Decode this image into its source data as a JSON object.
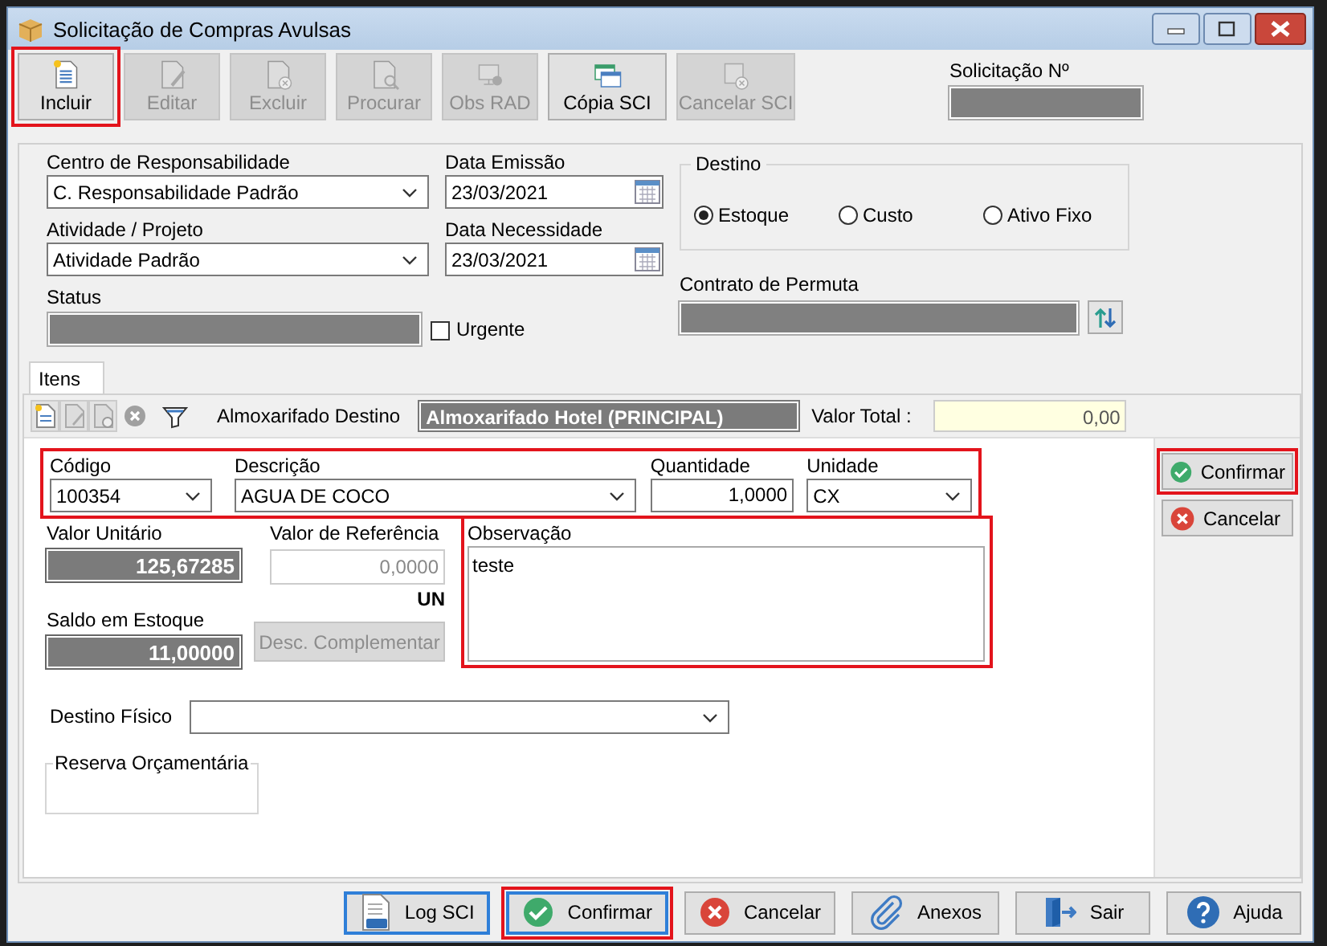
{
  "window": {
    "title": "Solicitação de Compras Avulsas"
  },
  "toolbar": [
    {
      "kind": "new",
      "label": "Incluir",
      "disabled": false,
      "highlighted": true
    },
    {
      "kind": "edit",
      "label": "Editar",
      "disabled": true,
      "highlighted": false
    },
    {
      "kind": "delete",
      "label": "Excluir",
      "disabled": true,
      "highlighted": false
    },
    {
      "kind": "search",
      "label": "Procurar",
      "disabled": true,
      "highlighted": false
    },
    {
      "kind": "note",
      "label": "Obs RAD",
      "disabled": true,
      "highlighted": false
    },
    {
      "kind": "copy",
      "label": "Cópia SCI",
      "disabled": false,
      "highlighted": false
    },
    {
      "kind": "cancel",
      "label": "Cancelar SCI",
      "disabled": true,
      "highlighted": false
    }
  ],
  "request_number": {
    "label": "Solicitação Nº"
  },
  "header": {
    "responsibility_center": {
      "label": "Centro de Responsabilidade",
      "value": "C. Responsabilidade Padrão"
    },
    "activity": {
      "label": "Atividade / Projeto",
      "value": "Atividade Padrão"
    },
    "status": {
      "label": "Status"
    },
    "urgent": {
      "label": "Urgente",
      "checked": false
    },
    "issue_date": {
      "label": "Data Emissão",
      "value": "23/03/2021"
    },
    "need_date": {
      "label": "Data Necessidade",
      "value": "23/03/2021"
    },
    "destination": {
      "title": "Destino",
      "options": [
        {
          "label": "Estoque",
          "selected": true
        },
        {
          "label": "Custo",
          "selected": false
        },
        {
          "label": "Ativo Fixo",
          "selected": false
        }
      ]
    },
    "exchange_contract": {
      "label": "Contrato de Permuta"
    }
  },
  "tabs": [
    {
      "label": "Itens",
      "selected": true
    }
  ],
  "items_bar": {
    "warehouse_label": "Almoxarifado Destino",
    "warehouse_value": "Almoxarifado Hotel (PRINCIPAL)",
    "total_label": "Valor Total :",
    "total_value": "0,00"
  },
  "item": {
    "code": {
      "label": "Código",
      "value": "100354"
    },
    "description": {
      "label": "Descrição",
      "value": "AGUA DE COCO"
    },
    "quantity": {
      "label": "Quantidade",
      "value": "1,0000"
    },
    "unit": {
      "label": "Unidade",
      "value": "CX"
    },
    "unit_value": {
      "label": "Valor Unitário",
      "value": "125,67285"
    },
    "reference_value": {
      "label": "Valor de Referência",
      "value": "0,0000"
    },
    "unit_hint": "UN",
    "stock_balance": {
      "label": "Saldo em Estoque",
      "value": "11,00000"
    },
    "complement_button": {
      "label": "Desc. Complementar",
      "disabled": true
    },
    "notes": {
      "label": "Observação",
      "value": "teste"
    },
    "physical_destination": {
      "label": "Destino Físico"
    },
    "budget_reserve": {
      "title": "Reserva Orçamentária"
    }
  },
  "side_buttons": [
    {
      "kind": "confirm",
      "label": "Confirmar",
      "highlighted": true
    },
    {
      "kind": "cancel",
      "label": "Cancelar",
      "highlighted": false
    }
  ],
  "footer_buttons": [
    {
      "kind": "log",
      "label": "Log SCI",
      "focused": true,
      "highlighted": false
    },
    {
      "kind": "confirm",
      "label": "Confirmar",
      "focused": true,
      "highlighted": true
    },
    {
      "kind": "cancel",
      "label": "Cancelar",
      "focused": false,
      "highlighted": false
    },
    {
      "kind": "attach",
      "label": "Anexos",
      "focused": false,
      "highlighted": false
    },
    {
      "kind": "exit",
      "label": "Sair",
      "focused": false,
      "highlighted": false
    },
    {
      "kind": "help",
      "label": "Ajuda",
      "focused": false,
      "highlighted": false
    }
  ]
}
